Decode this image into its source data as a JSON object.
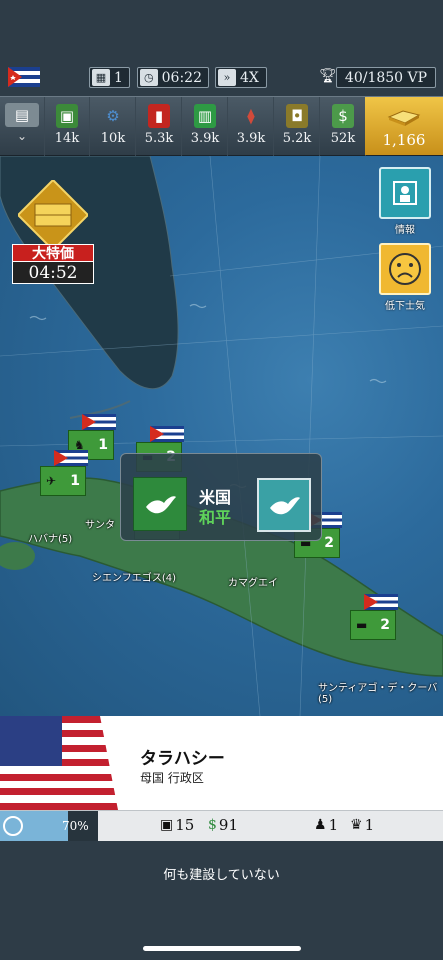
{
  "top": {
    "turns": "1",
    "time": "06:22",
    "speed": "4X",
    "victory_points": "40/1850 VP"
  },
  "resources": [
    {
      "name": "supplies",
      "value": "14k"
    },
    {
      "name": "industry",
      "value": "10k"
    },
    {
      "name": "fuel",
      "value": "5.3k"
    },
    {
      "name": "ammo",
      "value": "3.9k"
    },
    {
      "name": "research",
      "value": "3.9k"
    },
    {
      "name": "oil",
      "value": "5.2k"
    },
    {
      "name": "money",
      "value": "52k"
    }
  ],
  "gold": "1,166",
  "sale": {
    "title": "大特価",
    "timer": "04:52"
  },
  "side": {
    "info_label": "情報",
    "morale_label": "低下士気"
  },
  "units": [
    {
      "count": "1"
    },
    {
      "count": "2"
    },
    {
      "count": "1"
    },
    {
      "count": "2"
    },
    {
      "count": "2"
    },
    {
      "count": "2"
    }
  ],
  "map_labels": {
    "havana": "ハバナ(5)",
    "santa_clara": "サンタ",
    "cienfuegos": "シエンフエゴス(4)",
    "camaguey": "カマグエイ",
    "santiago": "サンティアゴ・デ・クーバ(5)"
  },
  "diplomacy": {
    "country": "米国",
    "status": "和平"
  },
  "city": {
    "name": "タラハシー",
    "subtitle": "母国 行政区",
    "morale_pct": "70%",
    "morale_value": 0.7,
    "supply": "15",
    "money": "91",
    "units": "1",
    "trophies": "1"
  },
  "bottom_text": "何も建設していない",
  "colors": {
    "accent_gold": "#e0a82a",
    "friendly_green": "#3f9a3a",
    "ocean": "#2c6a9c"
  }
}
